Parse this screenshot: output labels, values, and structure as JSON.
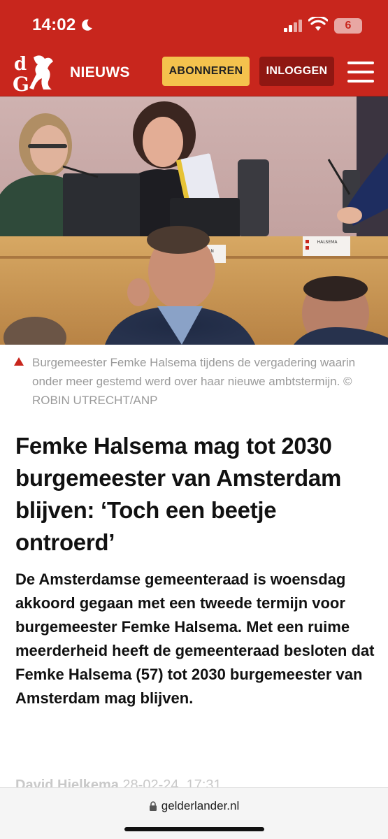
{
  "status": {
    "time": "14:02",
    "battery": "6"
  },
  "header": {
    "logo_letters": "dG",
    "brand": "NIEUWS",
    "subscribe_label": "ABONNEREN",
    "login_label": "INLOGGEN"
  },
  "hero": {
    "nameplate_left": "MAN",
    "nameplate_right": "HALSEMA"
  },
  "caption": "Burgemeester Femke Halsema tijdens de vergadering waarin onder meer gestemd werd over haar nieuwe ambtstermijn. © ROBIN UTRECHT/ANP",
  "article": {
    "headline": "Femke Halsema mag tot 2030 burgemeester van Amsterdam blijven: ‘Toch een beetje ontroerd’",
    "intro": "De Amsterdamse gemeenteraad is woensdag akkoord gegaan met een tweede termijn voor burgemeester Femke Halsema. Met een ruime meerderheid heeft de gemeenteraad besloten dat Femke Halsema (57) tot 2030 burgemeester van Amsterdam mag blijven.",
    "author": "David Hielkema",
    "date": "28-02-24, 17:31"
  },
  "browser": {
    "url": "gelderlander.nl"
  },
  "colors": {
    "brand_red": "#c8261d",
    "subscribe_yellow": "#f4c24d",
    "login_dark_red": "#8f1712"
  },
  "icons": [
    "moon-icon",
    "signal-icon",
    "wifi-icon",
    "battery-icon",
    "menu-icon",
    "warning-triangle-icon",
    "lock-icon"
  ]
}
